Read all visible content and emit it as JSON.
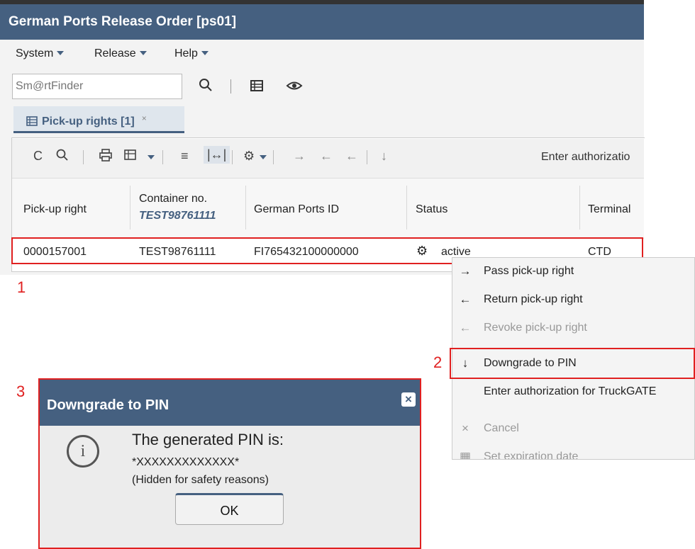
{
  "window": {
    "title": "German Ports Release Order [ps01]"
  },
  "menu": {
    "items": [
      "System",
      "Release",
      "Help"
    ]
  },
  "search": {
    "placeholder": "Sm@rtFinder"
  },
  "tab": {
    "label": "Pick-up rights [1]",
    "close": "×"
  },
  "toolbar": {
    "auth_text": "Enter authorizatio"
  },
  "table": {
    "columns": {
      "pickup": "Pick-up right",
      "container": "Container no.",
      "container_filter": "TEST98761111",
      "gpid": "German Ports ID",
      "status": "Status",
      "terminal": "Terminal"
    },
    "rows": [
      {
        "pickup": "0000157001",
        "container": "TEST98761111",
        "gpid": "FI765432100000000",
        "status": "active",
        "terminal": "CTD"
      }
    ]
  },
  "labels": {
    "one": "1",
    "two": "2",
    "three": "3"
  },
  "context_menu": {
    "items": [
      {
        "icon": "→",
        "label": "Pass pick-up right",
        "disabled": false
      },
      {
        "icon": "←",
        "label": "Return pick-up right",
        "disabled": false
      },
      {
        "icon": "←",
        "label": "Revoke pick-up right",
        "disabled": true
      },
      {
        "icon": "↓",
        "label": "Downgrade to PIN",
        "disabled": false
      },
      {
        "icon": "",
        "label": "Enter authorization for TruckGATE",
        "disabled": false
      },
      {
        "icon": "×",
        "label": "Cancel",
        "disabled": true
      },
      {
        "icon": "▦",
        "label": "Set expiration date",
        "disabled": true
      }
    ]
  },
  "dialog": {
    "title": "Downgrade to PIN",
    "close": "×",
    "message": "The generated PIN is:",
    "pin": "*XXXXXXXXXXXXX*",
    "note": "(Hidden for safety reasons)",
    "ok": "OK"
  },
  "colors": {
    "accent": "#456080",
    "highlight": "#e02020"
  }
}
